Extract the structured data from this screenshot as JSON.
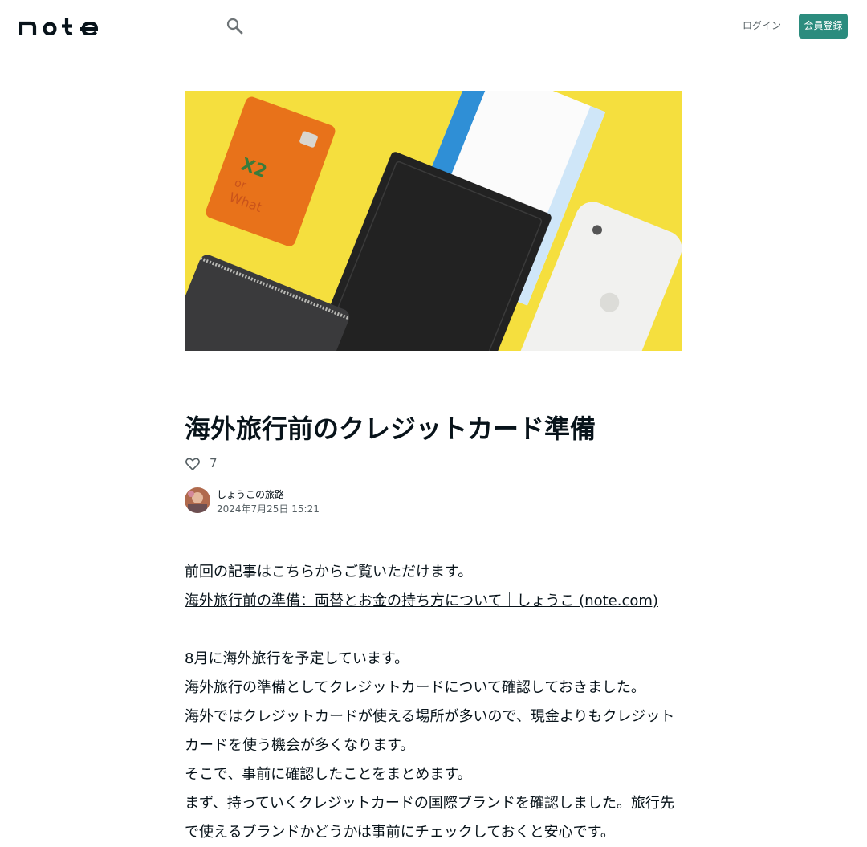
{
  "header": {
    "logo_text": "note",
    "search_icon": "search-icon",
    "login_label": "ログイン",
    "signup_label": "会員登録",
    "accent_color": "#2b8c7e"
  },
  "article": {
    "hero_image": "photo of a card, wallet with boarding pass and phone on yellow background",
    "title": "海外旅行前のクレジットカード準備",
    "likes": "7",
    "like_icon": "heart-icon",
    "author": {
      "name": "しょうこの旅路",
      "date": "2024年7月25日 15:21"
    },
    "body": {
      "p1": "前回の記事はこちらからご覧いただけます。",
      "link_text": "海外旅行前の準備：両替とお金の持ち方について｜しょうこ (note.com)",
      "p2": "8月に海外旅行を予定しています。",
      "p3": "海外旅行の準備としてクレジットカードについて確認しておきました。",
      "p4": "海外ではクレジットカードが使える場所が多いので、現金よりもクレジットカードを使う機会が多くなります。",
      "p5": "そこで、事前に確認したことをまとめます。",
      "p6": "まず、持っていくクレジットカードの国際ブランドを確認しました。旅行先で使えるブランドかどうかは事前にチェックしておくと安心です。"
    }
  }
}
